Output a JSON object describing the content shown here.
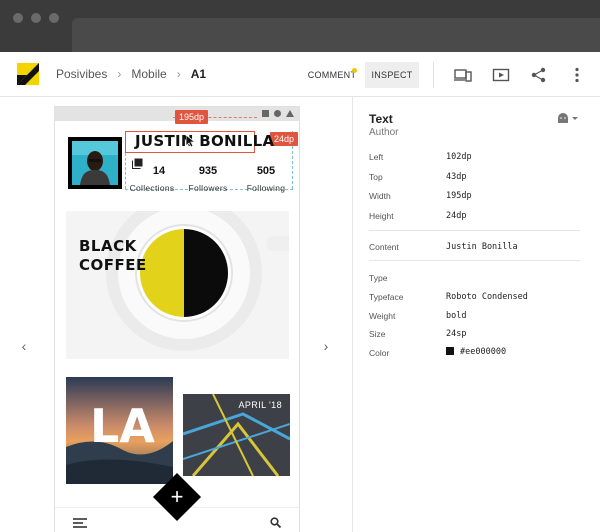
{
  "breadcrumb": {
    "items": [
      "Posivibes",
      "Mobile"
    ],
    "current": "A1"
  },
  "toolbar": {
    "comment_label": "COMMENT",
    "inspect_label": "INSPECT"
  },
  "colors": {
    "accent": "#e05540",
    "logo_yellow": "#f3d300",
    "coffee_yellow": "#e2d31a",
    "text": "#222222"
  },
  "icons": [
    "device-icon",
    "play-icon",
    "share-icon",
    "more-vert-icon",
    "android-icon",
    "chevron-left-icon",
    "chevron-right-icon",
    "menu-icon",
    "search-icon",
    "add-icon"
  ],
  "device": {
    "name": "JUSTIN BONILLA",
    "measure_width": "195dp",
    "measure_height": "24dp",
    "stats": [
      {
        "value": "14",
        "label": "Collections"
      },
      {
        "value": "935",
        "label": "Followers"
      },
      {
        "value": "505",
        "label": "Following"
      }
    ],
    "coffee_line1": "BLACK",
    "coffee_line2": "COFFEE",
    "la_text": "LA",
    "date_label": "APRIL '18"
  },
  "inspector": {
    "title": "Text",
    "subtitle": "Author",
    "layout": [
      {
        "label": "Left",
        "value": "102dp"
      },
      {
        "label": "Top",
        "value": "43dp"
      },
      {
        "label": "Width",
        "value": "195dp"
      },
      {
        "label": "Height",
        "value": "24dp"
      }
    ],
    "content_label": "Content",
    "content_value": "Justin Bonilla",
    "type_heading": "Type",
    "type": [
      {
        "label": "Typeface",
        "value": "Roboto Condensed"
      },
      {
        "label": "Weight",
        "value": "bold"
      },
      {
        "label": "Size",
        "value": "24sp"
      }
    ],
    "color_label": "Color",
    "color_value": "#ee000000"
  }
}
